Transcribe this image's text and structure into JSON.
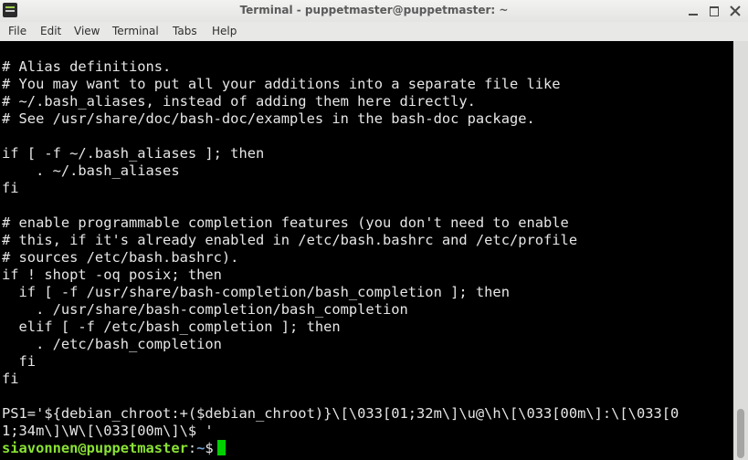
{
  "window": {
    "title": "Terminal - puppetmaster@puppetmaster: ~"
  },
  "menu": [
    "File",
    "Edit",
    "View",
    "Terminal",
    "Tabs",
    "Help"
  ],
  "terminal": {
    "lines": [
      "# Alias definitions.",
      "# You may want to put all your additions into a separate file like",
      "# ~/.bash_aliases, instead of adding them here directly.",
      "# See /usr/share/doc/bash-doc/examples in the bash-doc package.",
      "",
      "if [ -f ~/.bash_aliases ]; then",
      "    . ~/.bash_aliases",
      "fi",
      "",
      "# enable programmable completion features (you don't need to enable",
      "# this, if it's already enabled in /etc/bash.bashrc and /etc/profile",
      "# sources /etc/bash.bashrc).",
      "if ! shopt -oq posix; then",
      "  if [ -f /usr/share/bash-completion/bash_completion ]; then",
      "    . /usr/share/bash-completion/bash_completion",
      "  elif [ -f /etc/bash_completion ]; then",
      "    . /etc/bash_completion",
      "  fi",
      "fi",
      "",
      "PS1='${debian_chroot:+($debian_chroot)}\\[\\033[01;32m\\]\\u@\\h\\[\\033[00m\\]:\\[\\033[0",
      "1;34m\\]\\W\\[\\033[00m\\]\\$ '"
    ],
    "prompt": {
      "user_host": "siavonnen@puppetmaster",
      "separator": ":",
      "path": "~",
      "symbol": "$"
    }
  },
  "colors": {
    "background": "#000000",
    "text": "#e6e6e6",
    "prompt_user": "#8ae234",
    "prompt_path": "#729fcf",
    "cursor": "#00d000"
  }
}
